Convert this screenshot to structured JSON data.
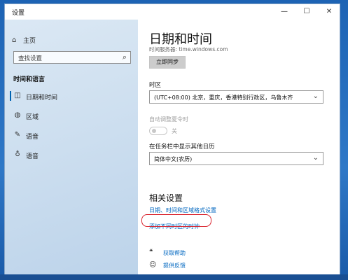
{
  "window": {
    "title": "设置",
    "controls": {
      "minimize": "—",
      "maximize": "☐",
      "close": "✕"
    }
  },
  "sidebar": {
    "home_label": "主页",
    "search_placeholder": "查找设置",
    "section_title": "时间和语言",
    "items": [
      {
        "label": "日期和时间",
        "icon": "calendar-clock-icon",
        "selected": true
      },
      {
        "label": "区域",
        "icon": "globe-icon",
        "selected": false
      },
      {
        "label": "语音",
        "icon": "microphone-speech-icon",
        "selected": false
      },
      {
        "label": "语音",
        "icon": "microphone-icon",
        "selected": false
      }
    ]
  },
  "content": {
    "title": "日期和时间",
    "sync_info": "时间服务器: time.windows.com",
    "sync_button": "立即同步",
    "timezone_label": "时区",
    "timezone_value": "(UTC+08:00) 北京，重庆，香港特别行政区，乌鲁木齐",
    "dst_label": "自动调整夏令时",
    "dst_toggle_label": "关",
    "dst_toggle_on": false,
    "calendar_label": "在任务栏中显示其他日历",
    "calendar_value": "简体中文(农历)",
    "related_title": "相关设置",
    "related_links": [
      "日期、时间和区域格式设置",
      "添加不同时区的时钟"
    ],
    "help_links": [
      {
        "label": "获取帮助",
        "icon": "help-chat-icon"
      },
      {
        "label": "提供反馈",
        "icon": "feedback-person-icon"
      }
    ]
  },
  "colors": {
    "accent": "#0067c0",
    "annotation": "#d9232d",
    "selected_indicator": "#0063b1"
  }
}
